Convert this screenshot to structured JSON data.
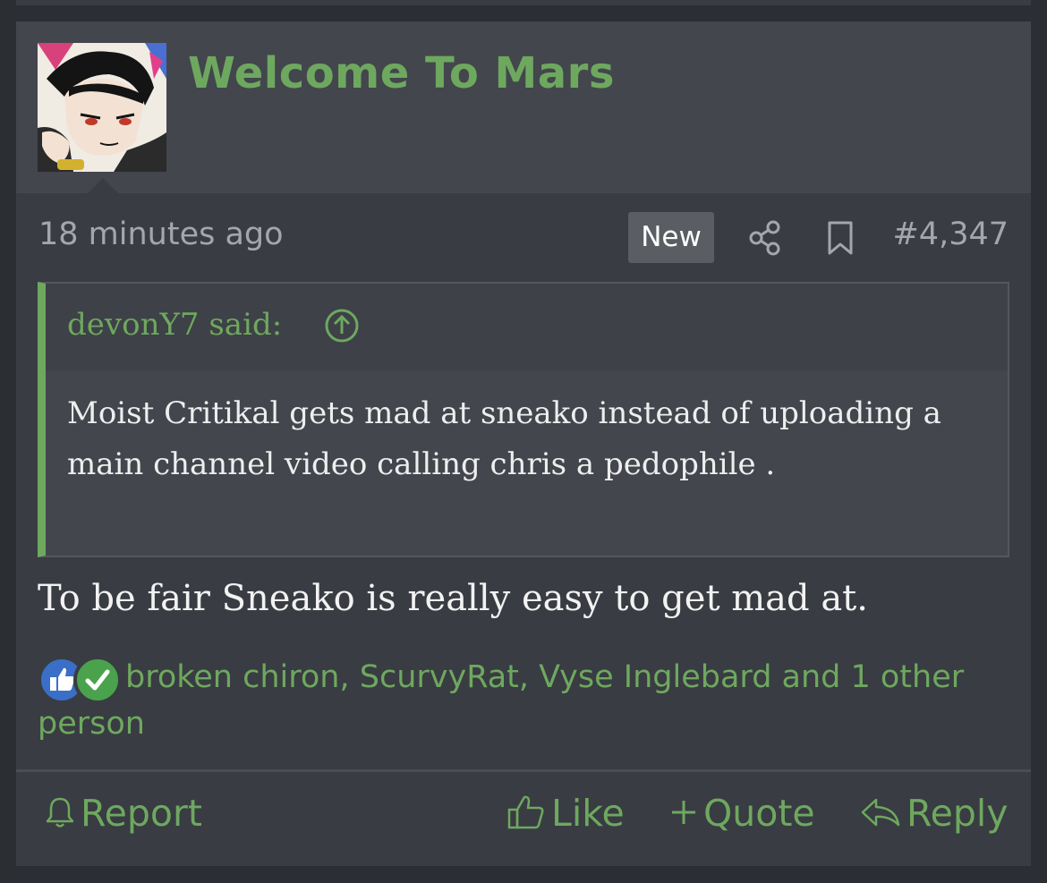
{
  "post": {
    "username": "Welcome To Mars",
    "time": "18 minutes ago",
    "badge": "New",
    "number": "#4,347",
    "quote": {
      "author": "devonY7 said:",
      "text": "Moist Critikal gets mad at sneako instead of uploading a main channel video calling chris a pedophile ."
    },
    "message": "To be fair Sneako is really easy to get mad at.",
    "reactions": {
      "names": "broken chiron, ScurvyRat, Vyse Inglebard and 1 other person",
      "icons": [
        "like-reaction-icon",
        "check-reaction-icon"
      ]
    },
    "actions": {
      "report": "Report",
      "like": "Like",
      "quote": "Quote",
      "reply": "Reply"
    }
  },
  "colors": {
    "accent": "#6ea85f",
    "background": "#2b2e33",
    "post_bg": "#393c42",
    "header_bg": "#43464d",
    "muted_text": "#a3a7ad"
  }
}
